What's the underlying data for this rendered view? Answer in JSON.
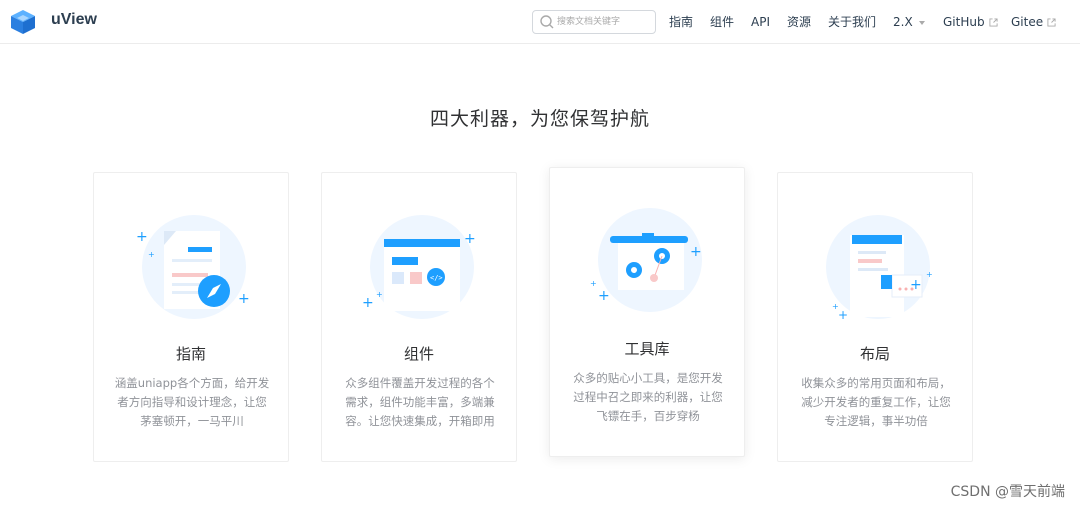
{
  "app": {
    "brand": "uView",
    "search_placeholder": "搜索文档关键字"
  },
  "nav": {
    "items": [
      {
        "label": "指南"
      },
      {
        "label": "组件"
      },
      {
        "label": "API"
      },
      {
        "label": "资源"
      },
      {
        "label": "关于我们"
      },
      {
        "label": "2.X"
      },
      {
        "label": "GitHub"
      },
      {
        "label": "Gitee"
      }
    ]
  },
  "main": {
    "title": "四大利器，为您保驾护航",
    "cards": [
      {
        "title": "指南",
        "description": "涵盖uniapp各个方面，给开发者方向指导和设计理念，让您茅塞顿开，一马平川"
      },
      {
        "title": "组件",
        "description": "众多组件覆盖开发过程的各个需求，组件功能丰富，多端兼容。让您快速集成，开箱即用"
      },
      {
        "title": "工具库",
        "description": "众多的贴心小工具，是您开发过程中召之即来的利器，让您飞镖在手，百步穿杨"
      },
      {
        "title": "布局",
        "description": "收集众多的常用页面和布局，减少开发者的重复工作，让您专注逻辑，事半功倍"
      }
    ]
  },
  "watermark": "CSDN @雪天前端",
  "colors": {
    "accent": "#1e9fff",
    "circle_bg": "#eef6ff",
    "pink": "#f9c9c9"
  }
}
